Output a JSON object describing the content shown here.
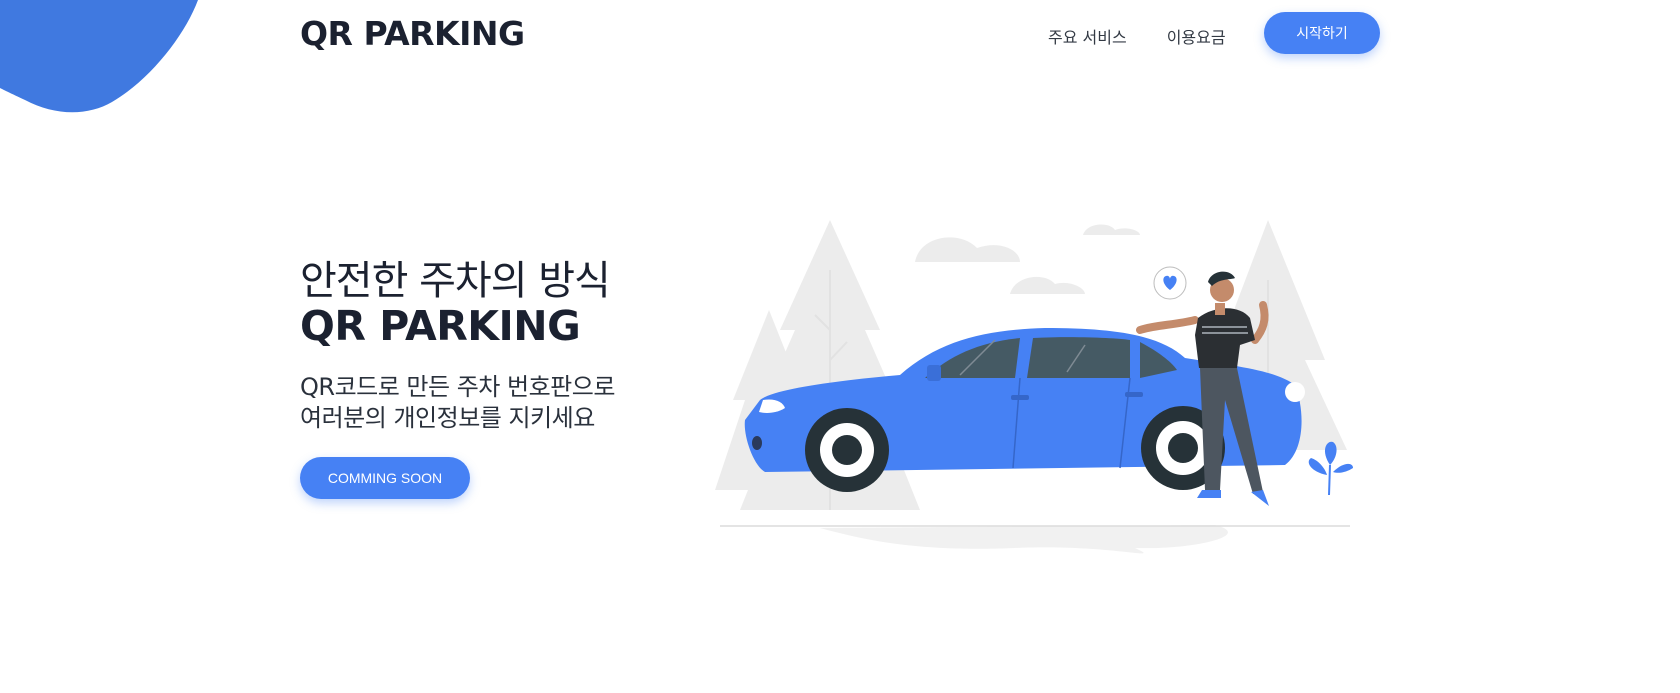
{
  "brand": {
    "logo": "QR PARKING",
    "accent": "#4681f4"
  },
  "nav": {
    "links": [
      "주요 서비스",
      "이용요금"
    ],
    "cta": "시작하기"
  },
  "hero": {
    "line1": "안전한 주차의 방식",
    "line2": "QR PARKING",
    "subtitle": [
      "QR코드로 만든 주차 번호판으로",
      "여러분의 개인정보를 지키세요"
    ],
    "button": "COMMING SOON"
  },
  "illustration": {
    "subject": "person-with-blue-car",
    "colors": {
      "car": "#4681f4",
      "trees": "#ececec",
      "shirt": "#2b2f33",
      "pants": "#4d5660"
    }
  }
}
